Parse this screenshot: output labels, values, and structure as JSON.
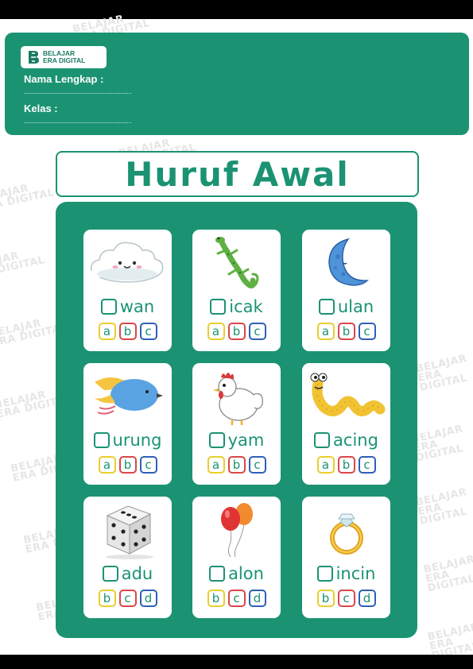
{
  "brand": {
    "line1": "BELAJAR",
    "line2": "ERA DIGITAL"
  },
  "form": {
    "name_label": "Nama Lengkap :",
    "class_label": "Kelas :"
  },
  "title": "Huruf Awal",
  "colors": {
    "primary": "#1b9373",
    "option_border_1": "#e8cf2e",
    "option_border_2": "#d9474a",
    "option_border_3": "#2f5fb8"
  },
  "cards": [
    {
      "icon": "cloud-icon",
      "word": "wan",
      "options": [
        "a",
        "b",
        "c"
      ]
    },
    {
      "icon": "lizard-icon",
      "word": "icak",
      "options": [
        "a",
        "b",
        "c"
      ]
    },
    {
      "icon": "moon-icon",
      "word": "ulan",
      "options": [
        "a",
        "b",
        "c"
      ]
    },
    {
      "icon": "bird-icon",
      "word": "urung",
      "options": [
        "a",
        "b",
        "c"
      ]
    },
    {
      "icon": "chicken-icon",
      "word": "yam",
      "options": [
        "a",
        "b",
        "c"
      ]
    },
    {
      "icon": "worm-icon",
      "word": "acing",
      "options": [
        "a",
        "b",
        "c"
      ]
    },
    {
      "icon": "dice-icon",
      "word": "adu",
      "options": [
        "b",
        "c",
        "d"
      ]
    },
    {
      "icon": "balloon-icon",
      "word": "alon",
      "options": [
        "b",
        "c",
        "d"
      ]
    },
    {
      "icon": "ring-icon",
      "word": "incin",
      "options": [
        "b",
        "c",
        "d"
      ]
    }
  ]
}
